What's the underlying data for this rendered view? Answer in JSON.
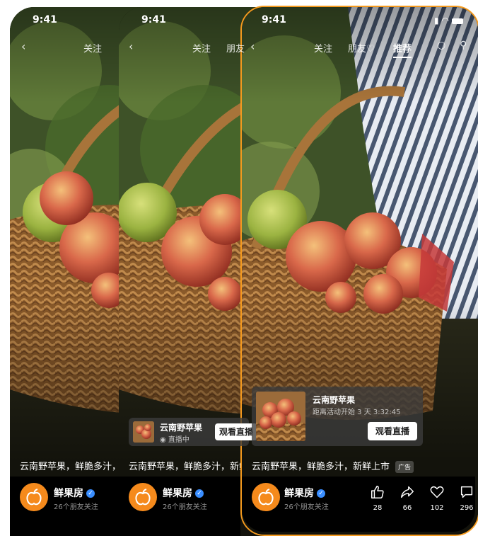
{
  "status": {
    "time": "9:41"
  },
  "nav": {
    "follow": "关注",
    "friends": "朋友",
    "recommend": "推荐"
  },
  "caption": {
    "text": "云南野苹果，鲜脆多汁，新鲜上市",
    "ad_tag": "广告"
  },
  "account": {
    "name": "鲜果房",
    "followers": "26个朋友关注"
  },
  "live_card_small": {
    "title": "云南野苹果",
    "status": "直播中",
    "button": "观看直播"
  },
  "live_card_large": {
    "title": "云南野苹果",
    "countdown": "距离活动开始 3 天 3:32:45",
    "button": "观看直播"
  },
  "actions": {
    "like": "28",
    "share": "66",
    "favorite": "102",
    "comment": "296"
  },
  "colors": {
    "accent": "#f59a1e",
    "avatar": "#f58a1c",
    "verified": "#3a8eff"
  }
}
